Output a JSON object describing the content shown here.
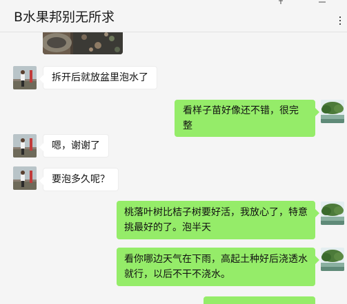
{
  "chat": {
    "title": "B水果邦别无所求"
  },
  "messages": [
    {
      "side": "left",
      "text": "拆开后就放盆里泡水了"
    },
    {
      "side": "right",
      "text": "看样子苗好像还不错，很完整"
    },
    {
      "side": "left",
      "text": "嗯，谢谢了"
    },
    {
      "side": "left",
      "text": "要泡多久呢？"
    },
    {
      "side": "right",
      "text": "桃落叶树比桔子树要好活，我放心了，特意挑最好的了。泡半天"
    },
    {
      "side": "right",
      "text": "看你哪边天气在下雨，高起土种好后浇透水就行，以后不干不浇水。"
    }
  ],
  "icons": {
    "pin": "pin-icon",
    "minimize": "minimize-icon",
    "more": "more-icon"
  },
  "colors": {
    "background": "#f5f5f5",
    "outgoing_bubble": "#95ec69",
    "incoming_bubble": "#ffffff"
  }
}
